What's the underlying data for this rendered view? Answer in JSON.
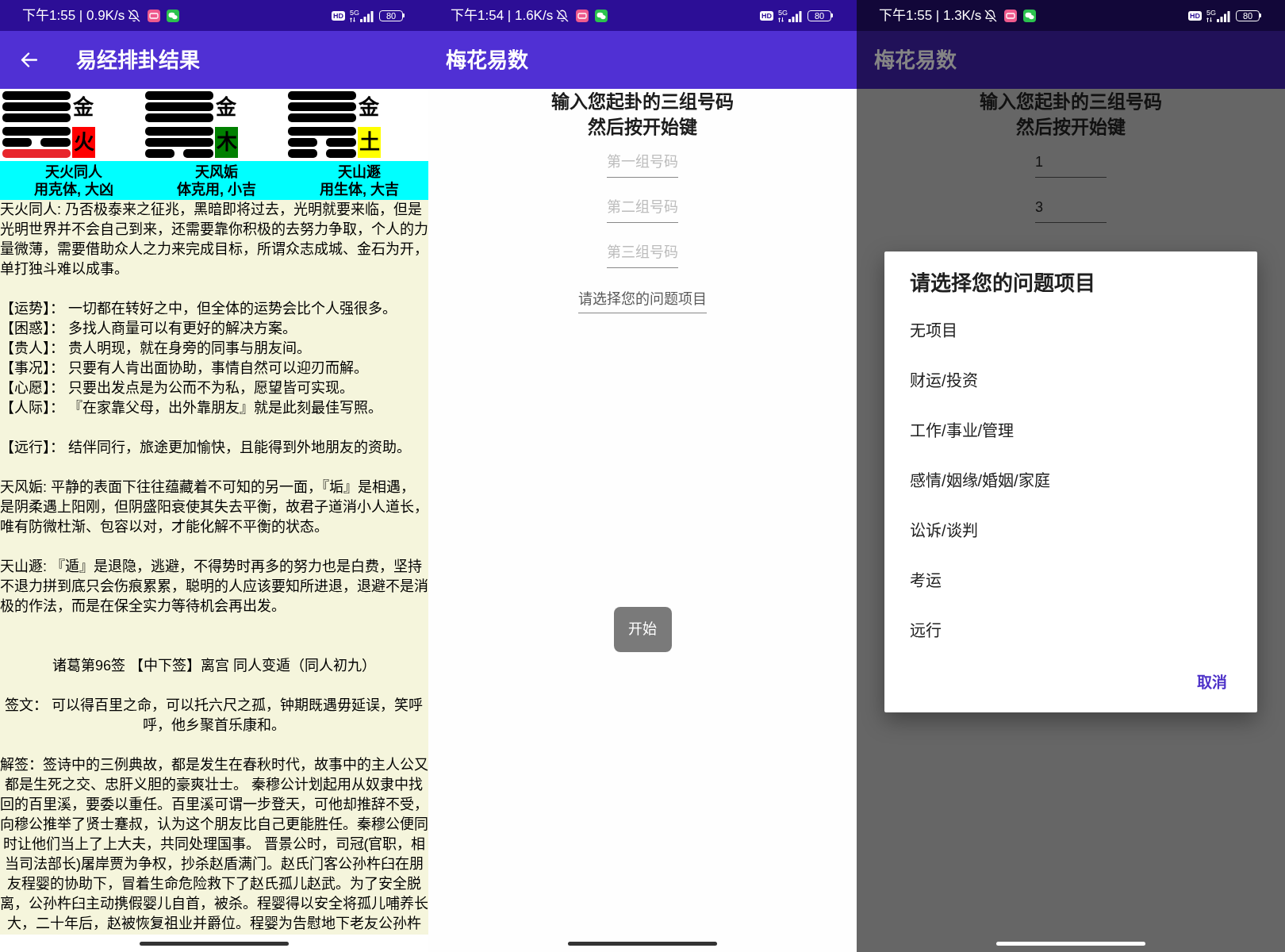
{
  "screens": [
    {
      "kind": "result",
      "status_bar": {
        "text": "下午1:55 | 0.9K/s",
        "hd": "HD",
        "network": "5G",
        "battery": "80"
      },
      "app_bar": {
        "title": "易经排卦结果",
        "back": true
      },
      "hexagrams": [
        {
          "upper": {
            "lines": [
              {
                "kind": "yang",
                "changing": false
              },
              {
                "kind": "yang",
                "changing": false
              },
              {
                "kind": "yang",
                "changing": false
              }
            ],
            "element": {
              "text": "金"
            }
          },
          "lower": {
            "lines": [
              {
                "kind": "yang",
                "changing": false
              },
              {
                "kind": "yin",
                "changing": false
              },
              {
                "kind": "yang",
                "changing": true
              }
            ],
            "element": {
              "text": "火",
              "color": "#ff0000"
            }
          },
          "name": "天火同人",
          "verdict": "用克体, 大凶"
        },
        {
          "upper": {
            "lines": [
              {
                "kind": "yang",
                "changing": false
              },
              {
                "kind": "yang",
                "changing": false
              },
              {
                "kind": "yang",
                "changing": false
              }
            ],
            "element": {
              "text": "金"
            }
          },
          "lower": {
            "lines": [
              {
                "kind": "yang",
                "changing": false
              },
              {
                "kind": "yang",
                "changing": false
              },
              {
                "kind": "yin",
                "changing": false
              }
            ],
            "element": {
              "text": "木",
              "color": "#008000"
            }
          },
          "name": "天风姤",
          "verdict": "体克用, 小吉"
        },
        {
          "upper": {
            "lines": [
              {
                "kind": "yang",
                "changing": false
              },
              {
                "kind": "yang",
                "changing": false
              },
              {
                "kind": "yang",
                "changing": false
              }
            ],
            "element": {
              "text": "金"
            }
          },
          "lower": {
            "lines": [
              {
                "kind": "yang",
                "changing": false
              },
              {
                "kind": "yin",
                "changing": false
              },
              {
                "kind": "yin",
                "changing": false
              }
            ],
            "element": {
              "text": "土",
              "color": "#ffff00"
            }
          },
          "name": "天山遯",
          "verdict": "用生体, 大吉"
        }
      ],
      "body": [
        {
          "kind": "paragraph",
          "text": "天火同人: 乃否极泰来之征兆，黑暗即将过去，光明就要来临，但是光明世界并不会自己到来，还需要靠你积极的去努力争取，个人的力量微薄，需要借助众人之力来完成目标，所谓众志成城、金石为开，单打独斗难以成事。"
        },
        {
          "kind": "aspects",
          "items": [
            "【运势】： 一切都在转好之中，但全体的运势会比个人强很多。",
            "【困惑】： 多找人商量可以有更好的解决方案。",
            "【贵人】： 贵人明现，就在身旁的同事与朋友间。",
            "【事况】： 只要有人肯出面协助，事情自然可以迎刃而解。",
            "【心愿】： 只要出发点是为公而不为私，愿望皆可实现。",
            "【人际】： 『在家靠父母，出外靠朋友』就是此刻最佳写照。"
          ]
        },
        {
          "kind": "aspects",
          "items": [
            "【远行】： 结伴同行，旅途更加愉快，且能得到外地朋友的资助。"
          ]
        },
        {
          "kind": "paragraph",
          "text": "天风姤: 平静的表面下往往蕴藏着不可知的另一面，『垢』是相遇，是阴柔遇上阳刚，但阴盛阳衰使其失去平衡，故君子道消小人道长，唯有防微杜渐、包容以对，才能化解不平衡的状态。"
        },
        {
          "kind": "paragraph",
          "text": "天山遯: 『遁』是退隐，逃避，不得势时再多的努力也是白费，坚持不退力拼到底只会伤痕累累，聪明的人应该要知所进退，退避不是消极的作法，而是在保全实力等待机会再出发。"
        },
        {
          "kind": "heading",
          "text": "诸葛第96签 【中下签】离宫 同人变遁（同人初九）"
        },
        {
          "kind": "centered",
          "text": "签文： 可以得百里之命，可以托六尺之孤，钟期既遇毋延误，笑呼呼，他乡聚首乐康和。"
        },
        {
          "kind": "centered",
          "text": "解签：签诗中的三例典故，都是发生在春秋时代，故事中的主人公又都是生死之交、忠肝义胆的豪爽壮士。 秦穆公计划起用从奴隶中找回的百里溪，要委以重任。百里溪可谓一步登天，可他却推辞不受，向穆公推举了贤士蹇叔，认为这个朋友比自己更能胜任。秦穆公便同时让他们当上了上大夫，共同处理国事。 晋景公时，司冠(官职，相当司法部长)屠岸贾为争权，抄杀赵盾满门。赵氏门客公孙杵臼在朋友程婴的协助下，冒着生命危险救下了赵氏孤儿赵武。为了安全脱离，公孙杵臼主动携假婴儿自首，被杀。程婴得以安全将孤儿哺养长大，二十年后，赵被恢复祖业并爵位。程婴为告慰地下老友公孙杵"
        }
      ]
    },
    {
      "kind": "form",
      "status_bar": {
        "text": "下午1:54 | 1.6K/s",
        "hd": "HD",
        "network": "5G",
        "battery": "80"
      },
      "app_bar": {
        "title": "梅花易数"
      },
      "prompt": [
        "输入您起卦的三组号码",
        "然后按开始键"
      ],
      "fields": [
        {
          "placeholder": "第一组号码"
        },
        {
          "placeholder": "第二组号码"
        },
        {
          "placeholder": "第三组号码"
        }
      ],
      "select": {
        "placeholder": "请选择您的问题项目"
      },
      "start_button": "开始"
    },
    {
      "kind": "form",
      "status_bar": {
        "text": "下午1:55 | 1.3K/s",
        "hd": "HD",
        "network": "5G",
        "battery": "80"
      },
      "app_bar": {
        "title": "梅花易数"
      },
      "prompt": [
        "输入您起卦的三组号码",
        "然后按开始键"
      ],
      "fields": [
        {
          "value": "1"
        },
        {
          "value": "3"
        }
      ],
      "dialog": {
        "title": "请选择您的问题项目",
        "options": [
          {
            "label": "无项目",
            "selected": false
          },
          {
            "label": "财运/投资",
            "selected": false
          },
          {
            "label": "工作/事业/管理",
            "selected": false
          },
          {
            "label": "感情/姻缘/婚姻/家庭",
            "selected": false
          },
          {
            "label": "讼诉/谈判",
            "selected": false
          },
          {
            "label": "考运",
            "selected": false
          },
          {
            "label": "远行",
            "selected": false
          }
        ],
        "cancel": "取消"
      }
    }
  ]
}
